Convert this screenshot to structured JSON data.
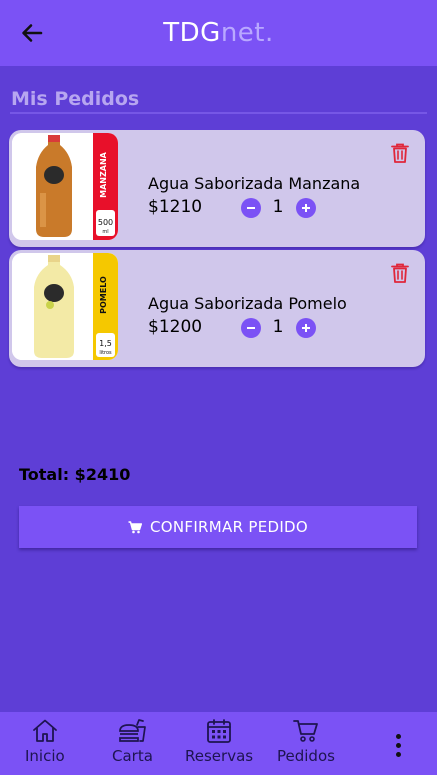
{
  "app_bar": {
    "brand_main": "TDG",
    "brand_suffix": "net."
  },
  "page": {
    "title": "Mis Pedidos"
  },
  "orders": [
    {
      "name": "Agua Saborizada Manzana",
      "price": "$1210",
      "quantity": "1",
      "label_flavor": "MANZANA",
      "label_size": "500",
      "label_unit": "ml",
      "label_color": "#e8102a",
      "liquid_color": "#c97a2a"
    },
    {
      "name": "Agua Saborizada Pomelo",
      "price": "$1200",
      "quantity": "1",
      "label_flavor": "POMELO",
      "label_size": "1,5",
      "label_unit": "litros",
      "label_color": "#f5c800",
      "liquid_color": "#f3eaa6"
    }
  ],
  "summary": {
    "total": "Total: $2410",
    "confirm_label": "CONFIRMAR PEDIDO"
  },
  "bottom_nav": {
    "items": [
      {
        "label": "Inicio",
        "icon": "home-icon"
      },
      {
        "label": "Carta",
        "icon": "burger-drink-icon"
      },
      {
        "label": "Reservas",
        "icon": "calendar-icon"
      },
      {
        "label": "Pedidos",
        "icon": "cart-icon"
      }
    ],
    "more_icon": "more-vertical-icon"
  },
  "colors": {
    "background": "#5e3ed6",
    "primary": "#7b52f5",
    "card": "#d0c7eb",
    "delete": "#e0263a"
  }
}
